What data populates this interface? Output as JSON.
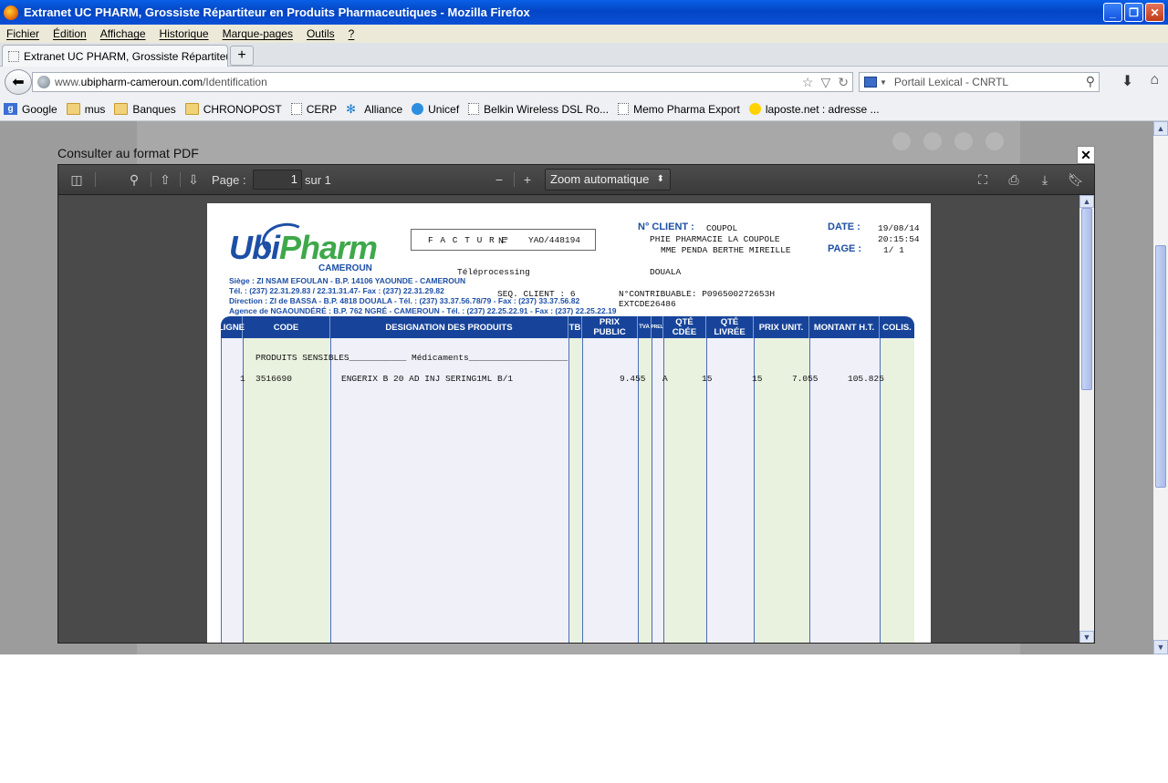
{
  "window": {
    "title": "Extranet UC PHARM, Grossiste Répartiteur en Produits Pharmaceutiques - Mozilla Firefox"
  },
  "menu": [
    "Fichier",
    "Édition",
    "Affichage",
    "Historique",
    "Marque-pages",
    "Outils",
    "?"
  ],
  "tab": {
    "label": "Extranet UC PHARM, Grossiste Répartiteur ..."
  },
  "address": {
    "prefix": "www.",
    "domain": "ubipharm-cameroun.com",
    "path": "/Identification"
  },
  "search": {
    "engine_label": "Portail Lexical - CNRTL"
  },
  "bookmarks": [
    {
      "label": "Google",
      "icon": "google-icon"
    },
    {
      "label": "mus",
      "icon": "folder-icon"
    },
    {
      "label": "Banques",
      "icon": "folder-icon"
    },
    {
      "label": "CHRONOPOST",
      "icon": "folder-icon"
    },
    {
      "label": "CERP",
      "icon": "page-icon"
    },
    {
      "label": "Alliance",
      "icon": "alliance-icon"
    },
    {
      "label": "Unicef",
      "icon": "unicef-icon"
    },
    {
      "label": "Belkin Wireless DSL Ro...",
      "icon": "page-icon"
    },
    {
      "label": "Memo Pharma Export",
      "icon": "page-icon"
    },
    {
      "label": "laposte.net : adresse ...",
      "icon": "laposte-icon"
    }
  ],
  "modal": {
    "caption": "Consulter au format PDF",
    "close_glyph": "✕"
  },
  "viewer": {
    "page_label": "Page :",
    "page_value": "1",
    "page_total": "sur 1",
    "zoom": "Zoom automatique"
  },
  "invoice": {
    "logo_ubi": "Ubi",
    "logo_pharm": "Pharm",
    "logo_country": "CAMEROUN",
    "address_lines": [
      "Siège : ZI NSAM EFOULAN - B.P. 14106 YAOUNDE - CAMEROUN",
      "Tél. : (237) 22.31.29.83 / 22.31.31.47- Fax : (237) 22.31.29.82",
      "Direction : ZI de BASSA - B.P. 4818 DOUALA - Tél. : (237) 33.37.56.78/79 - Fax : (237) 33.37.56.82",
      "Agence de NGAOUNDÉRÉ : B.P. 762 NGRÉ - CAMEROUN - Tél. : (237) 22.25.22.91 - Fax : (237) 22.25.22.19"
    ],
    "facture_label": "F A C T U R E",
    "numero_label": "N°",
    "facture_number": "YAO/448194",
    "client_label": "N° CLIENT :",
    "client_code": "COUPOL",
    "client_line1": "PHIE  PHARMACIE LA COUPOLE",
    "client_line2": "MME PENDA BERTHE MIREILLE",
    "date_label": "DATE :",
    "date_value": "19/08/14",
    "time_value": "20:15:54",
    "page_label": "PAGE :",
    "page_value": "1/   1",
    "teleprocessing": "Téléprocessing",
    "city": "DOUALA",
    "seq_client": "SEQ. CLIENT :     6",
    "contribuable": "N°CONTRIBUABLE: P096500272653H",
    "extcode": "EXTCDE26486",
    "columns": [
      "LIGNE",
      "CODE",
      "DESIGNATION DES PRODUITS",
      "TB",
      "PRIX PUBLIC",
      "TVA",
      "PREL",
      "QTÉ CDÉE",
      "QTÉ LIVRÉE",
      "PRIX UNIT.",
      "MONTANT H.T.",
      "COLIS."
    ],
    "section_line": "PRODUITS SENSIBLES___________ Médicaments___________________",
    "rows": [
      {
        "ligne": "1",
        "code": "3516690",
        "designation": "ENGERIX B 20 AD INJ SERING1ML B/1",
        "prix_public": "9.455",
        "tva": "A",
        "qte_cdee": "15",
        "qte_livree": "15",
        "prix_unit": "7.055",
        "montant": "105.825"
      }
    ]
  }
}
